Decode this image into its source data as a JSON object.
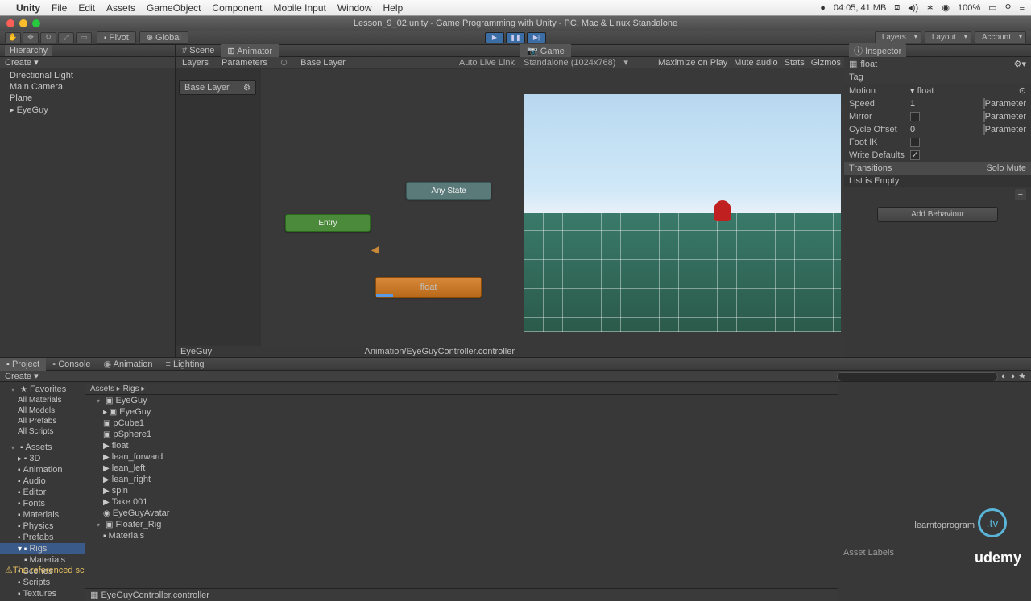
{
  "menubar": {
    "app": "Unity",
    "items": [
      "File",
      "Edit",
      "Assets",
      "GameObject",
      "Component",
      "Mobile Input",
      "Window",
      "Help"
    ],
    "time": "04:05, 41 MB",
    "battery": "100%"
  },
  "window": {
    "title": "Lesson_9_02.unity - Game Programming with Unity - PC, Mac & Linux Standalone"
  },
  "toolbar": {
    "pivot": "Pivot",
    "global": "Global",
    "layers": "Layers",
    "layout": "Layout",
    "account": "Account"
  },
  "hierarchy": {
    "tab": "Hierarchy",
    "create": "Create",
    "items": [
      "Directional Light",
      "Main Camera",
      "Plane",
      "EyeGuy"
    ]
  },
  "scene": {
    "tab": "Scene"
  },
  "animator": {
    "tab": "Animator",
    "subtabs": [
      "Layers",
      "Parameters"
    ],
    "layer": "Base Layer",
    "autolive": "Auto Live Link",
    "chip": "Base Layer",
    "nodes": {
      "any": "Any State",
      "entry": "Entry",
      "float": "float"
    },
    "footL": "EyeGuy",
    "footR": "Animation/EyeGuyController.controller"
  },
  "game": {
    "tab": "Game",
    "display": "Standalone (1024x768)",
    "opts": [
      "Maximize on Play",
      "Mute audio",
      "Stats",
      "Gizmos"
    ]
  },
  "inspector": {
    "tab": "Inspector",
    "name": "float",
    "tag": "Tag",
    "motion": "Motion",
    "motionVal": "float",
    "speed": "Speed",
    "speedVal": "1",
    "mirror": "Mirror",
    "cycle": "Cycle Offset",
    "cycleVal": "0",
    "footik": "Foot IK",
    "writedef": "Write Defaults",
    "transitions": "Transitions",
    "solo": "Solo",
    "mute": "Mute",
    "empty": "List is Empty",
    "param": "Parameter",
    "addbeh": "Add Behaviour"
  },
  "project": {
    "tabs": [
      "Project",
      "Console",
      "Animation",
      "Lighting"
    ],
    "create": "Create",
    "crumb": "Assets  ▸  Rigs  ▸",
    "favorites": "Favorites",
    "favs": [
      "All Materials",
      "All Models",
      "All Prefabs",
      "All Scripts"
    ],
    "assets": "Assets",
    "folders": [
      "3D",
      "Animation",
      "Audio",
      "Editor",
      "Fonts",
      "Materials",
      "Physics",
      "Prefabs",
      "Rigs",
      "Materials",
      "Scenes",
      "Scripts",
      "Textures"
    ],
    "midroot": "EyeGuy",
    "miditems": [
      "EyeGuy",
      "pCube1",
      "pSphere1",
      "float",
      "lean_forward",
      "lean_left",
      "lean_right",
      "spin",
      "Take 001",
      "EyeGuyAvatar"
    ],
    "mid2": "Floater_Rig",
    "mid2items": [
      "Materials"
    ],
    "foot": "EyeGuyController.controller",
    "labels": "Asset Labels"
  },
  "status": {
    "msg": "The referenced script on this Behaviour is missing!"
  },
  "brand": {
    "ltp": "learntoprogram",
    "tv": ".tv",
    "udemy": "udemy"
  }
}
